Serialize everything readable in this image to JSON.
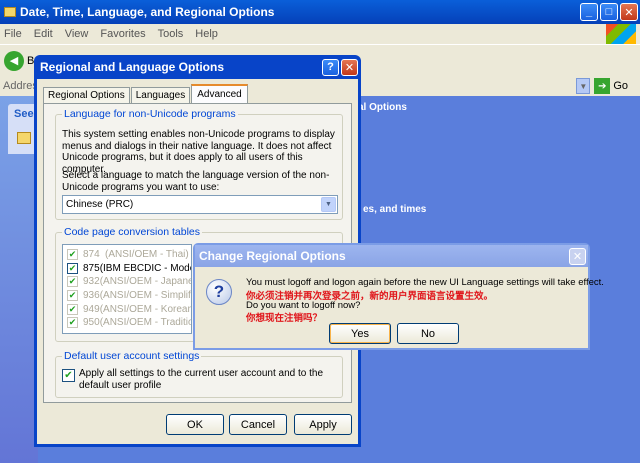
{
  "bg_window": {
    "title": "Date, Time, Language, and Regional Options",
    "menu": [
      "File",
      "Edit",
      "View",
      "Favorites",
      "Tools",
      "Help"
    ],
    "back_label": "Ba",
    "address_label": "Address",
    "go_label": "Go",
    "see_label": "See",
    "text_regional": "al Options",
    "text_dates": "es, and times"
  },
  "dialog": {
    "title": "Regional and Language Options",
    "tabs": [
      "Regional Options",
      "Languages",
      "Advanced"
    ],
    "nonunicode": {
      "label": "Language for non-Unicode programs",
      "desc": "This system setting enables non-Unicode programs to display menus and dialogs in their native language. It does not affect Unicode programs, but it does apply to all users of this computer.",
      "select_prompt": "Select a language to match the language version of the non-Unicode programs you want to use:",
      "selected": "Chinese (PRC)"
    },
    "codepage": {
      "label": "Code page conversion tables",
      "rows": [
        {
          "code": "874",
          "name": "(ANSI/OEM - Thai)",
          "enabled": false
        },
        {
          "code": "875",
          "name": "(IBM EBCDIC - Modern",
          "enabled": true
        },
        {
          "code": "932",
          "name": "(ANSI/OEM - Japanese",
          "enabled": false
        },
        {
          "code": "936",
          "name": "(ANSI/OEM - Simplified",
          "enabled": false
        },
        {
          "code": "949",
          "name": "(ANSI/OEM - Korean)",
          "enabled": false
        },
        {
          "code": "950",
          "name": "(ANSI/OEM - Traditional",
          "enabled": false
        }
      ]
    },
    "default_user": {
      "label": "Default user account settings",
      "checkbox_text": "Apply all settings to the current user account and to the default user profile"
    },
    "buttons": {
      "ok": "OK",
      "cancel": "Cancel",
      "apply": "Apply"
    }
  },
  "msgbox": {
    "title": "Change Regional Options",
    "line1": "You must logoff and logon again before the new UI Language settings will take effect.",
    "line1_cn": "你必须注销并再次登录之前，新的用户界面语言设置生效。",
    "line2": "Do you want to logoff now?",
    "line2_cn": "你想现在注销吗？",
    "yes": "Yes",
    "no": "No"
  }
}
